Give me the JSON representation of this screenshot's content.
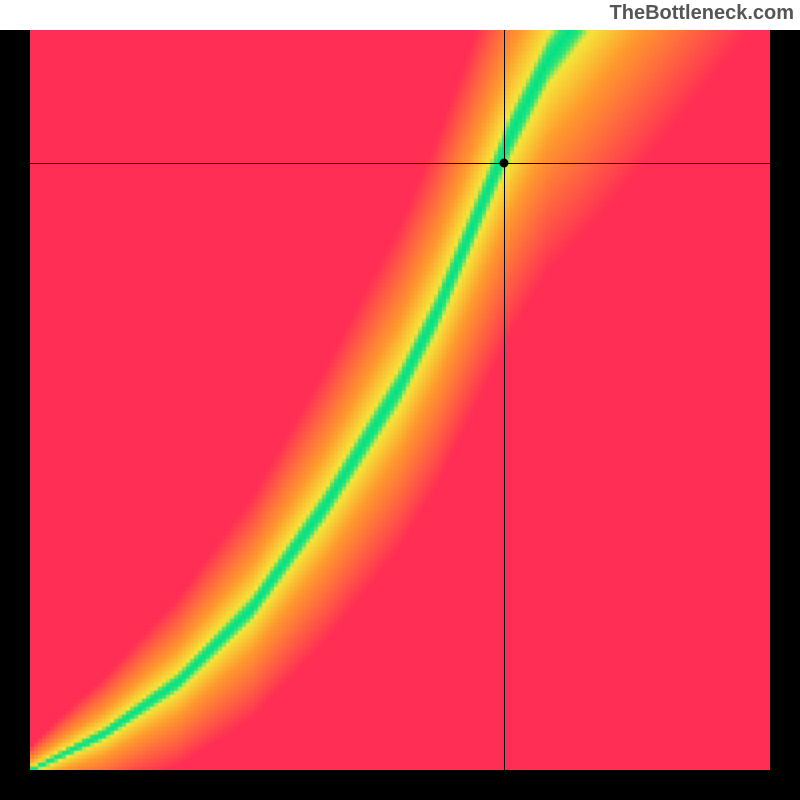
{
  "attribution": "TheBottleneck.com",
  "chart_data": {
    "type": "heatmap",
    "title": "",
    "xlabel": "",
    "ylabel": "",
    "xlim": [
      0,
      100
    ],
    "ylim": [
      0,
      100
    ],
    "colorscale": "green=balanced, yellow=mild bottleneck, orange/red=severe bottleneck",
    "optimal_ridge": [
      {
        "x": 0,
        "y": 0
      },
      {
        "x": 10,
        "y": 5
      },
      {
        "x": 20,
        "y": 12
      },
      {
        "x": 30,
        "y": 22
      },
      {
        "x": 40,
        "y": 36
      },
      {
        "x": 50,
        "y": 52
      },
      {
        "x": 55,
        "y": 62
      },
      {
        "x": 60,
        "y": 74
      },
      {
        "x": 65,
        "y": 86
      },
      {
        "x": 70,
        "y": 96
      },
      {
        "x": 73,
        "y": 100
      }
    ],
    "crosshair": {
      "x": 64,
      "y": 82,
      "note": "selected component pair; sits slightly right of the balanced (green) ridge"
    },
    "colors": {
      "balanced": "#00E288",
      "mild": "#F6E63A",
      "moderate": "#FF9A2E",
      "severe": "#FF2E55"
    }
  }
}
